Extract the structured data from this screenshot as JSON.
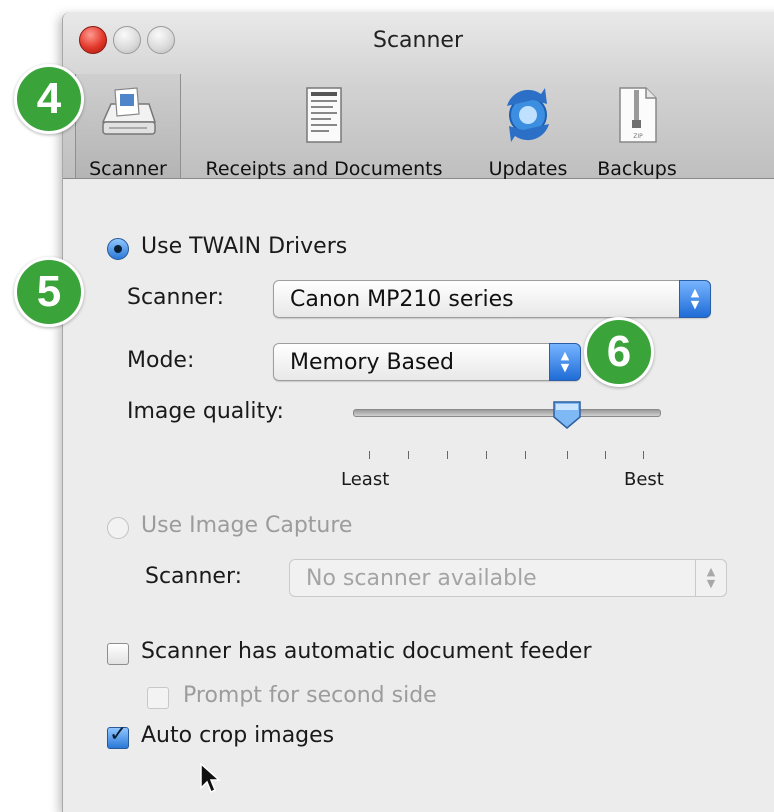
{
  "window": {
    "title": "Scanner"
  },
  "toolbar": {
    "items": [
      {
        "label": "Scanner",
        "icon": "scanner-icon"
      },
      {
        "label": "Receipts and Documents",
        "icon": "receipt-icon"
      },
      {
        "label": "Updates",
        "icon": "updates-icon"
      },
      {
        "label": "Backups",
        "icon": "zip-file-icon"
      }
    ],
    "selected_index": 0
  },
  "twain": {
    "radio_label": "Use TWAIN Drivers",
    "selected": true,
    "scanner_label": "Scanner:",
    "scanner_value": "Canon MP210 series",
    "mode_label": "Mode:",
    "mode_value": "Memory Based",
    "quality_label": "Image quality:",
    "quality_min_label": "Least",
    "quality_max_label": "Best",
    "quality_level": 0.67
  },
  "image_capture": {
    "radio_label": "Use Image Capture",
    "selected": false,
    "enabled": false,
    "scanner_label": "Scanner:",
    "scanner_value": "No scanner available"
  },
  "options": {
    "adf_label": "Scanner has automatic document feeder",
    "adf_checked": false,
    "second_side_label": "Prompt for second side",
    "second_side_checked": false,
    "second_side_enabled": false,
    "autocrop_label": "Auto crop images",
    "autocrop_checked": true
  },
  "callouts": [
    "4",
    "5",
    "6"
  ],
  "colors": {
    "callout": "#3aa33a",
    "accent": "#2a78d6"
  }
}
